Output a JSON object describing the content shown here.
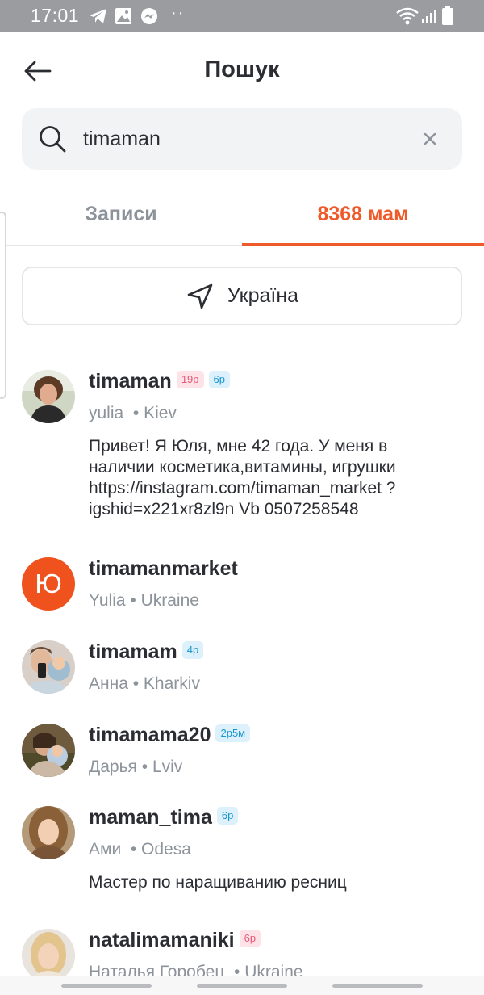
{
  "status_bar": {
    "time": "17:01",
    "icons": [
      "telegram-icon",
      "gallery-icon",
      "messenger-icon",
      "wifi-icon",
      "signal-icon",
      "battery-icon"
    ]
  },
  "header": {
    "back_icon": "arrow-left-icon",
    "title": "Пошук"
  },
  "search": {
    "value": "timaman",
    "icon": "search-icon",
    "clear_icon": "close-icon"
  },
  "tabs": [
    {
      "label": "Записи",
      "active": false
    },
    {
      "label": "8368 мам",
      "active": true
    }
  ],
  "location_filter": {
    "icon": "navigation-arrow-icon",
    "label": "Україна"
  },
  "users": [
    {
      "username": "timaman",
      "badges": [
        {
          "text": "19р",
          "color": "pink"
        },
        {
          "text": "6р",
          "color": "blue"
        }
      ],
      "name": "yulia",
      "city": "Kiev",
      "bio": "Привет! Я Юля, мне 42 года. У меня в наличии косметика,витамины, игрушки https://instagram.com/timaman_market ?igshid=x221xr8zl9n Vb 0507258548"
    },
    {
      "username": "timamanmarket",
      "badges": [],
      "avatar_letter": "Ю",
      "name": "Yulia",
      "city": "Ukraine",
      "bio": ""
    },
    {
      "username": "timamam",
      "badges": [
        {
          "text": "4р",
          "color": "blue"
        }
      ],
      "name": "Анна",
      "city": "Kharkiv",
      "bio": ""
    },
    {
      "username": "timamama20",
      "badges": [
        {
          "text": "2р5м",
          "color": "blue"
        }
      ],
      "name": "Дарья",
      "city": "Lviv",
      "bio": ""
    },
    {
      "username": "maman_tima",
      "badges": [
        {
          "text": "6р",
          "color": "blue"
        }
      ],
      "name": "Ами",
      "city": "Odesa",
      "bio": "Мастер по наращиванию ресниц"
    },
    {
      "username": "natalimamaniki",
      "badges": [
        {
          "text": "6р",
          "color": "pink"
        }
      ],
      "name": "Наталья Горобец",
      "city": "Ukraine",
      "bio": ""
    }
  ],
  "colors": {
    "accent": "#ef5a2a",
    "avatar_letter_bg": "#f0521e",
    "badge_pink": "#e85878",
    "badge_blue": "#1a95cf",
    "muted_text": "#8c939b"
  }
}
